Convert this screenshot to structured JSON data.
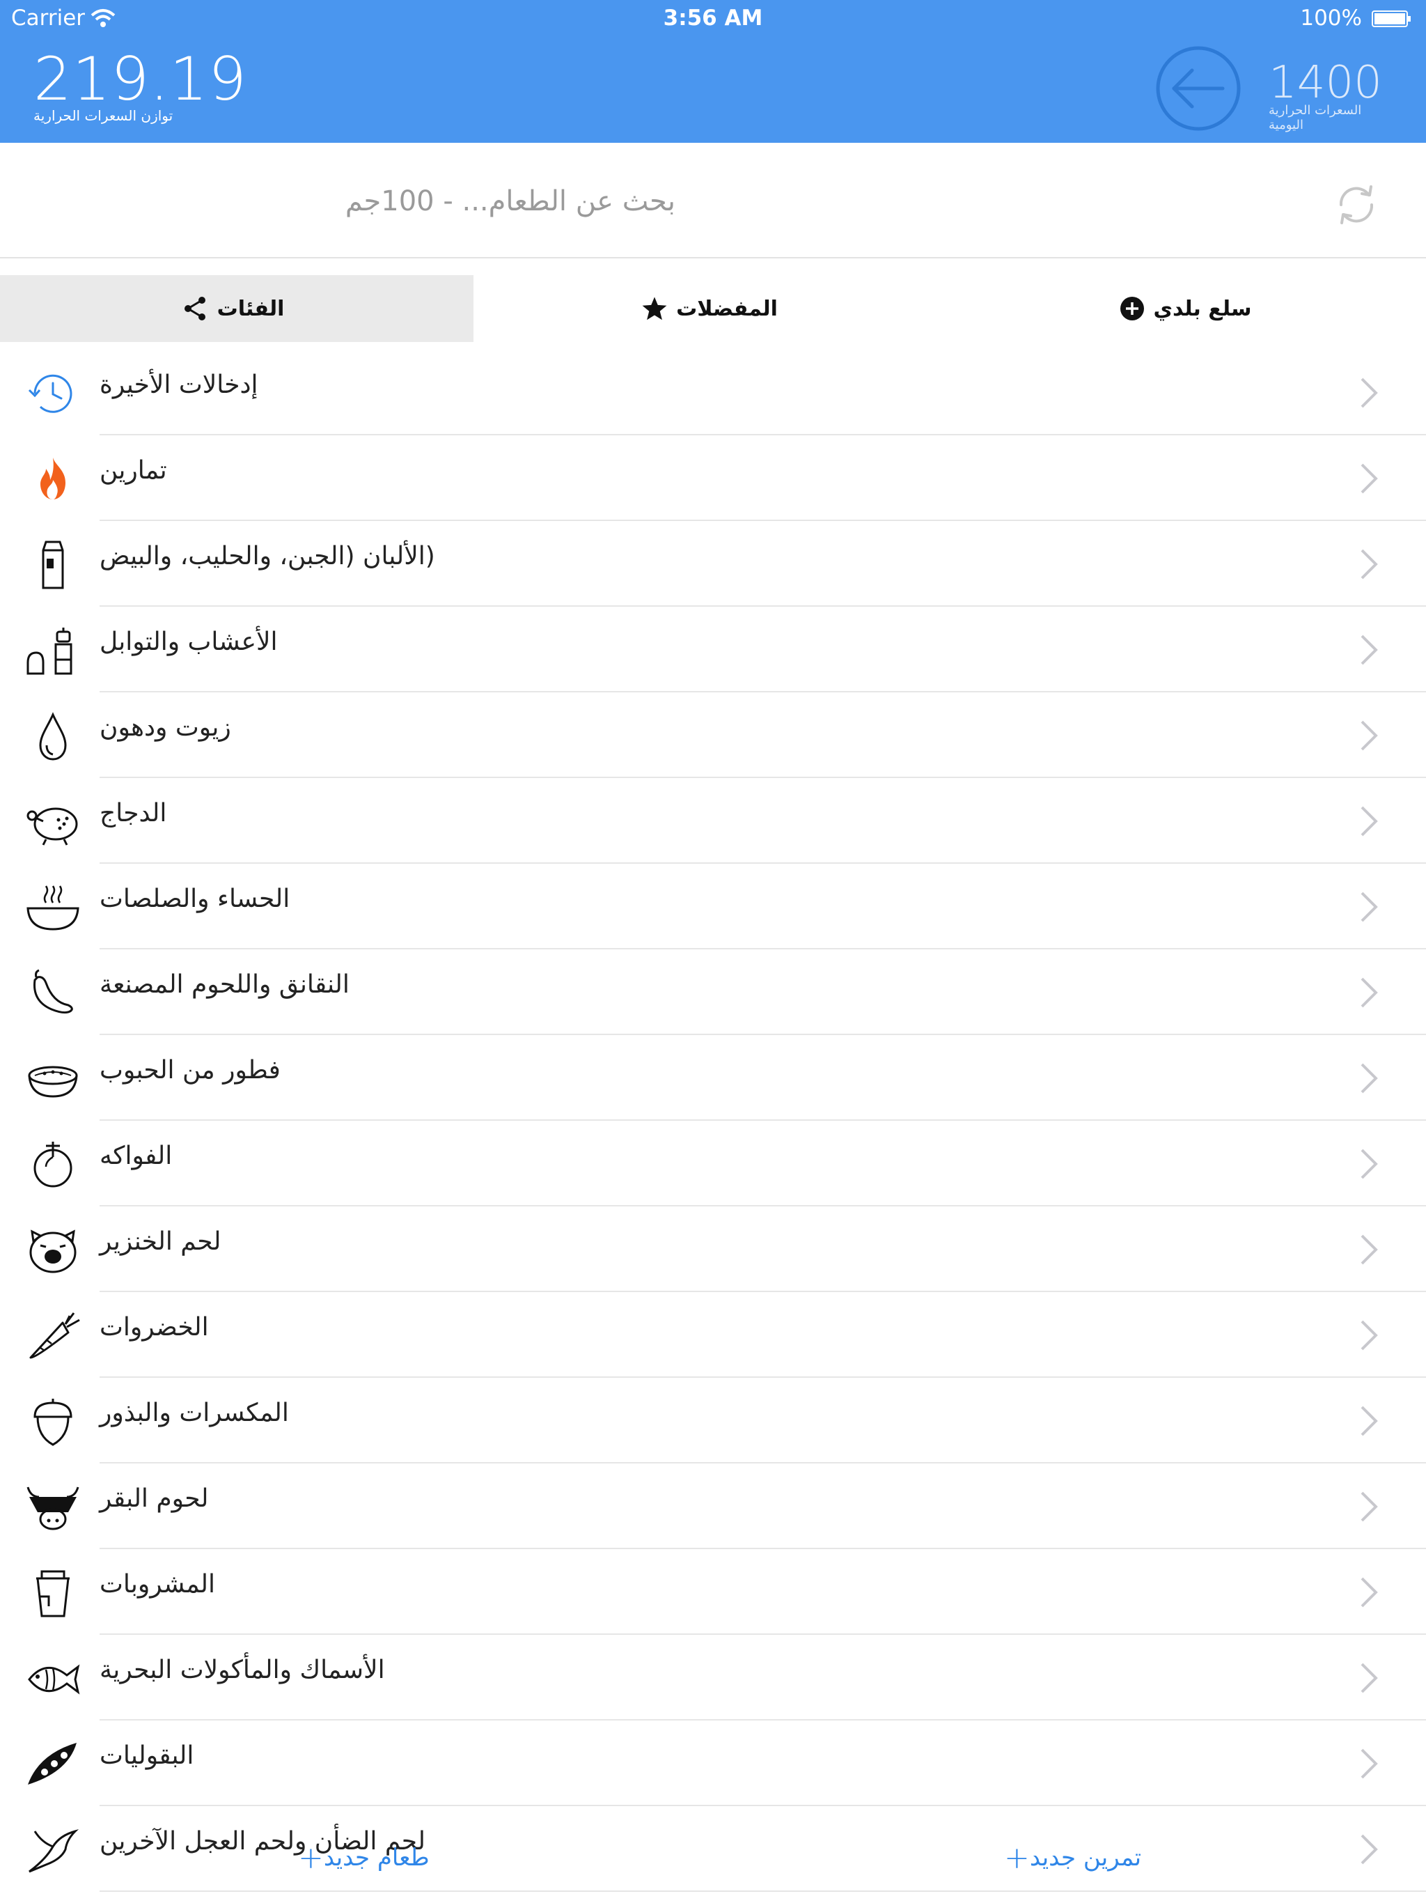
{
  "status_bar": {
    "carrier": "Carrier",
    "time": "3:56 AM",
    "battery": "100%"
  },
  "header": {
    "balance_value": "219.19",
    "balance_label": "توازن السعرات الحرارية",
    "daily_value": "1400",
    "daily_label": "السعرات الحرارية اليومية",
    "back_icon": "arrow-left-circle-icon"
  },
  "search": {
    "placeholder": "بحث عن الطعام... - 100جم",
    "refresh_icon": "refresh-icon"
  },
  "tabs": [
    {
      "label": "الفئات",
      "icon": "share-icon",
      "selected": true
    },
    {
      "label": "المفضلات",
      "icon": "star-icon",
      "selected": false
    },
    {
      "label": "سلع بلدي",
      "icon": "plus-circle-icon",
      "selected": false
    }
  ],
  "categories": [
    {
      "label": "إدخالات الأخيرة",
      "icon": "history-clock-icon"
    },
    {
      "label": "تمارين",
      "icon": "flame-icon"
    },
    {
      "label": "(الألبان (الجبن، والحليب، والبيض",
      "icon": "milk-carton-icon"
    },
    {
      "label": "الأعشاب والتوابل",
      "icon": "spice-grinder-icon"
    },
    {
      "label": "زيوت ودهون",
      "icon": "oil-drop-icon"
    },
    {
      "label": "الدجاج",
      "icon": "roast-chicken-icon"
    },
    {
      "label": "الحساء والصلصات",
      "icon": "soup-bowl-icon"
    },
    {
      "label": "النقانق واللحوم المصنعة",
      "icon": "sausage-icon"
    },
    {
      "label": "فطور من الحبوب",
      "icon": "cereal-bowl-icon"
    },
    {
      "label": "الفواكه",
      "icon": "fruit-icon"
    },
    {
      "label": "لحم الخنزير",
      "icon": "pig-icon"
    },
    {
      "label": "الخضروات",
      "icon": "carrot-icon"
    },
    {
      "label": "المكسرات والبذور",
      "icon": "acorn-icon"
    },
    {
      "label": "لحوم البقر",
      "icon": "cow-icon"
    },
    {
      "label": "المشروبات",
      "icon": "cup-icon"
    },
    {
      "label": "الأسماك والمأكولات البحرية",
      "icon": "fish-icon"
    },
    {
      "label": "البقوليات",
      "icon": "pea-pod-icon"
    },
    {
      "label": "لحم الضأن ولحم العجل الآخرين",
      "icon": "bird-icon"
    }
  ],
  "bottom": {
    "new_food": "طعام جديد",
    "new_exercise": "تمرين جديد"
  },
  "colors": {
    "header": "#4a96ef",
    "accent": "#2f86e8",
    "flame": "#f2611c"
  }
}
